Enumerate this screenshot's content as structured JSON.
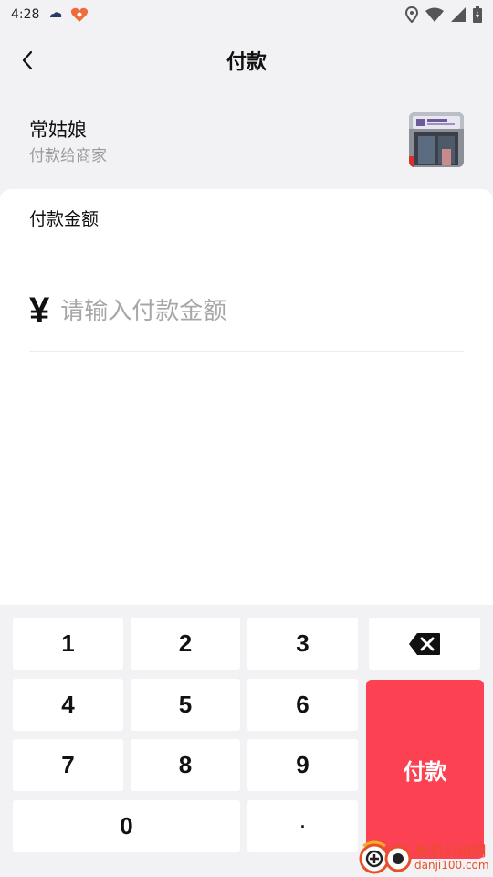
{
  "status_bar": {
    "time": "4:28"
  },
  "header": {
    "title": "付款"
  },
  "merchant": {
    "name": "常姑娘",
    "subtitle": "付款给商家"
  },
  "payment": {
    "amount_label": "付款金额",
    "currency_symbol": "¥",
    "amount_value": "",
    "amount_placeholder": "请输入付款金额"
  },
  "keypad": {
    "keys": [
      "1",
      "2",
      "3",
      "4",
      "5",
      "6",
      "7",
      "8",
      "9",
      "0",
      "."
    ],
    "pay_label": "付款",
    "backspace_icon": "backspace-icon"
  },
  "watermark": {
    "text1": "单机100网",
    "text2": "danji100.com"
  },
  "colors": {
    "background": "#f2f2f4",
    "pay_button": "#fb4152",
    "placeholder": "#a7a7a7",
    "watermark": "#e8502a"
  }
}
